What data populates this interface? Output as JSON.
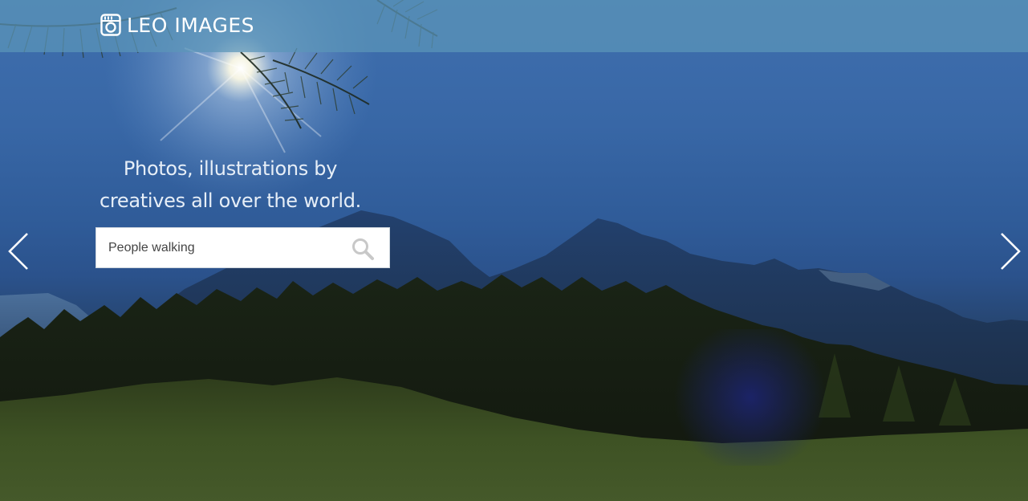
{
  "header": {
    "brand": "LEO IMAGES",
    "logo_icon": "instagram-camera-icon"
  },
  "hero": {
    "tagline_line1": "Photos, illustrations by",
    "tagline_line2": "creatives all over the world.",
    "background": "mountain-landscape-photo"
  },
  "search": {
    "value": "",
    "placeholder": "People walking",
    "icon": "search-icon"
  },
  "carousel": {
    "prev_icon": "chevron-left-icon",
    "next_icon": "chevron-right-icon"
  },
  "colors": {
    "header_bg": "#5c96b9",
    "sky": "#3867a6",
    "text": "#ffffff"
  }
}
